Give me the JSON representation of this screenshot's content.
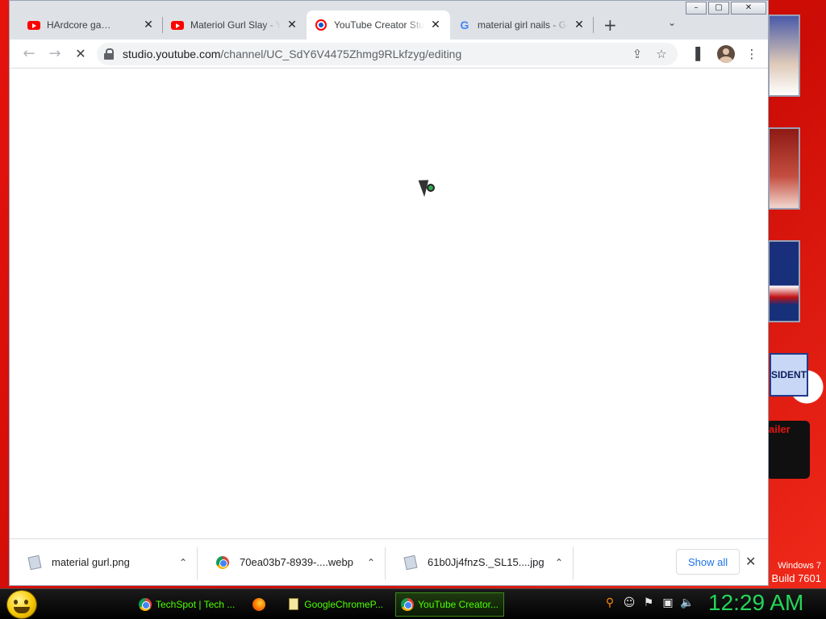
{
  "browser": {
    "tabs": [
      {
        "title": "HArdcore ga…",
        "favicon": "youtube-icon",
        "active": false
      },
      {
        "title": "Materiol Gurl Slay - Y",
        "favicon": "youtube-icon",
        "active": false
      },
      {
        "title": "YouTube Creator Stuc",
        "favicon": "youtube-studio-icon",
        "active": true
      },
      {
        "title": "material girl nails - Go",
        "favicon": "google-icon",
        "active": false
      }
    ],
    "new_tab_glyph": "+",
    "tab_search_glyph": "⌄",
    "url_host": "studio.youtube.com",
    "url_path": "/channel/UC_SdY6V4475Zhmg9RLkfzyg/editing",
    "reload_state": "loading"
  },
  "downloads": [
    {
      "name": "material gurl.png",
      "icon": "file-image-icon"
    },
    {
      "name": "70ea03b7-8939-....webp",
      "icon": "chrome-icon"
    },
    {
      "name": "61b0Jj4fnzS._SL15....jpg",
      "icon": "file-image-icon"
    }
  ],
  "downloads_show_all": "Show all",
  "taskbar": {
    "tasks": [
      {
        "label": "TechSpot | Tech ...",
        "icon": "chrome-icon",
        "active": false
      },
      {
        "label": "",
        "icon": "firefox-icon",
        "active": false
      },
      {
        "label": "GoogleChromeP...",
        "icon": "document-icon",
        "active": false
      },
      {
        "label": "YouTube Creator...",
        "icon": "chrome-icon",
        "active": true
      }
    ],
    "clock": "12:29 AM"
  },
  "desktop": {
    "badge_text": "SIDENT",
    "dark_card_text": "ailer",
    "watermark_line1": "Windows 7",
    "watermark_line2": "Build 7601"
  },
  "colors": {
    "taskbar_text": "#4cff00",
    "clock": "#24d65a",
    "wallpaper": "#e5130c",
    "link": "#1a73e8"
  }
}
